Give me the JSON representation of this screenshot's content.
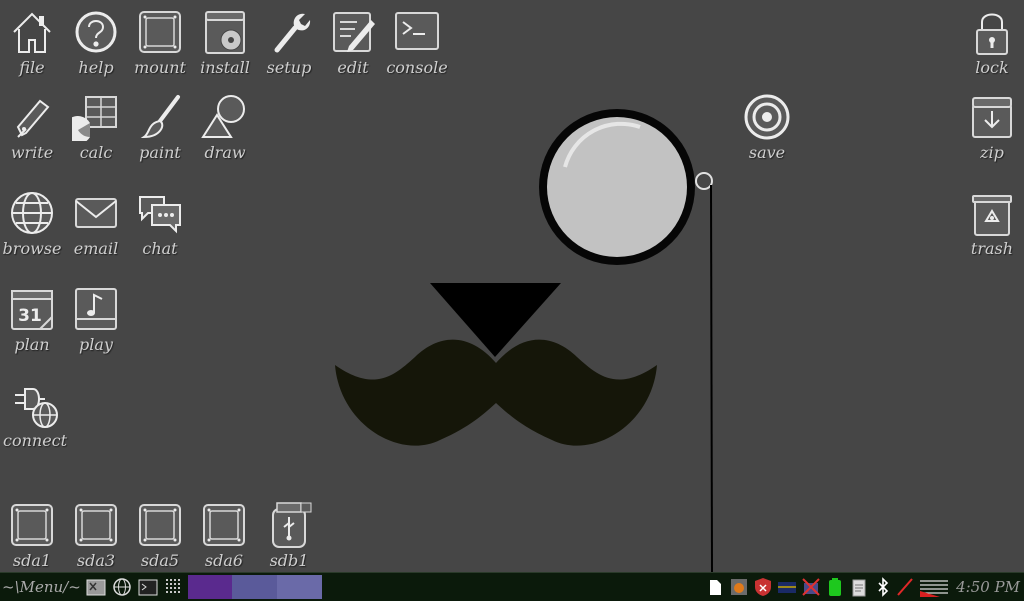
{
  "desktop": {
    "icons": {
      "file": "file",
      "help": "help",
      "mount": "mount",
      "install": "install",
      "setup": "setup",
      "edit": "edit",
      "console": "console",
      "write": "write",
      "calc": "calc",
      "paint": "paint",
      "draw": "draw",
      "browse": "browse",
      "email": "email",
      "chat": "chat",
      "plan": "plan",
      "play": "play",
      "connect": "connect",
      "save": "save",
      "lock": "lock",
      "zip": "zip",
      "trash": "trash",
      "sda1": "sda1",
      "sda3": "sda3",
      "sda5": "sda5",
      "sda6": "sda6",
      "sdb1": "sdb1"
    },
    "plan_day": "31"
  },
  "taskbar": {
    "menu_label": "~\\Menu/~",
    "clock": "4:50 PM",
    "pager_colors": [
      "#5a2a8e",
      "#5a5a9a",
      "#6a6aa8"
    ],
    "tray_icons": [
      "document-icon",
      "firewall-icon",
      "shield-icon",
      "keyboard-flag-icon",
      "network-disconnected-icon",
      "battery-icon",
      "clipboard-icon",
      "bluetooth-icon",
      "pencil-icon",
      "volume-icon"
    ]
  }
}
